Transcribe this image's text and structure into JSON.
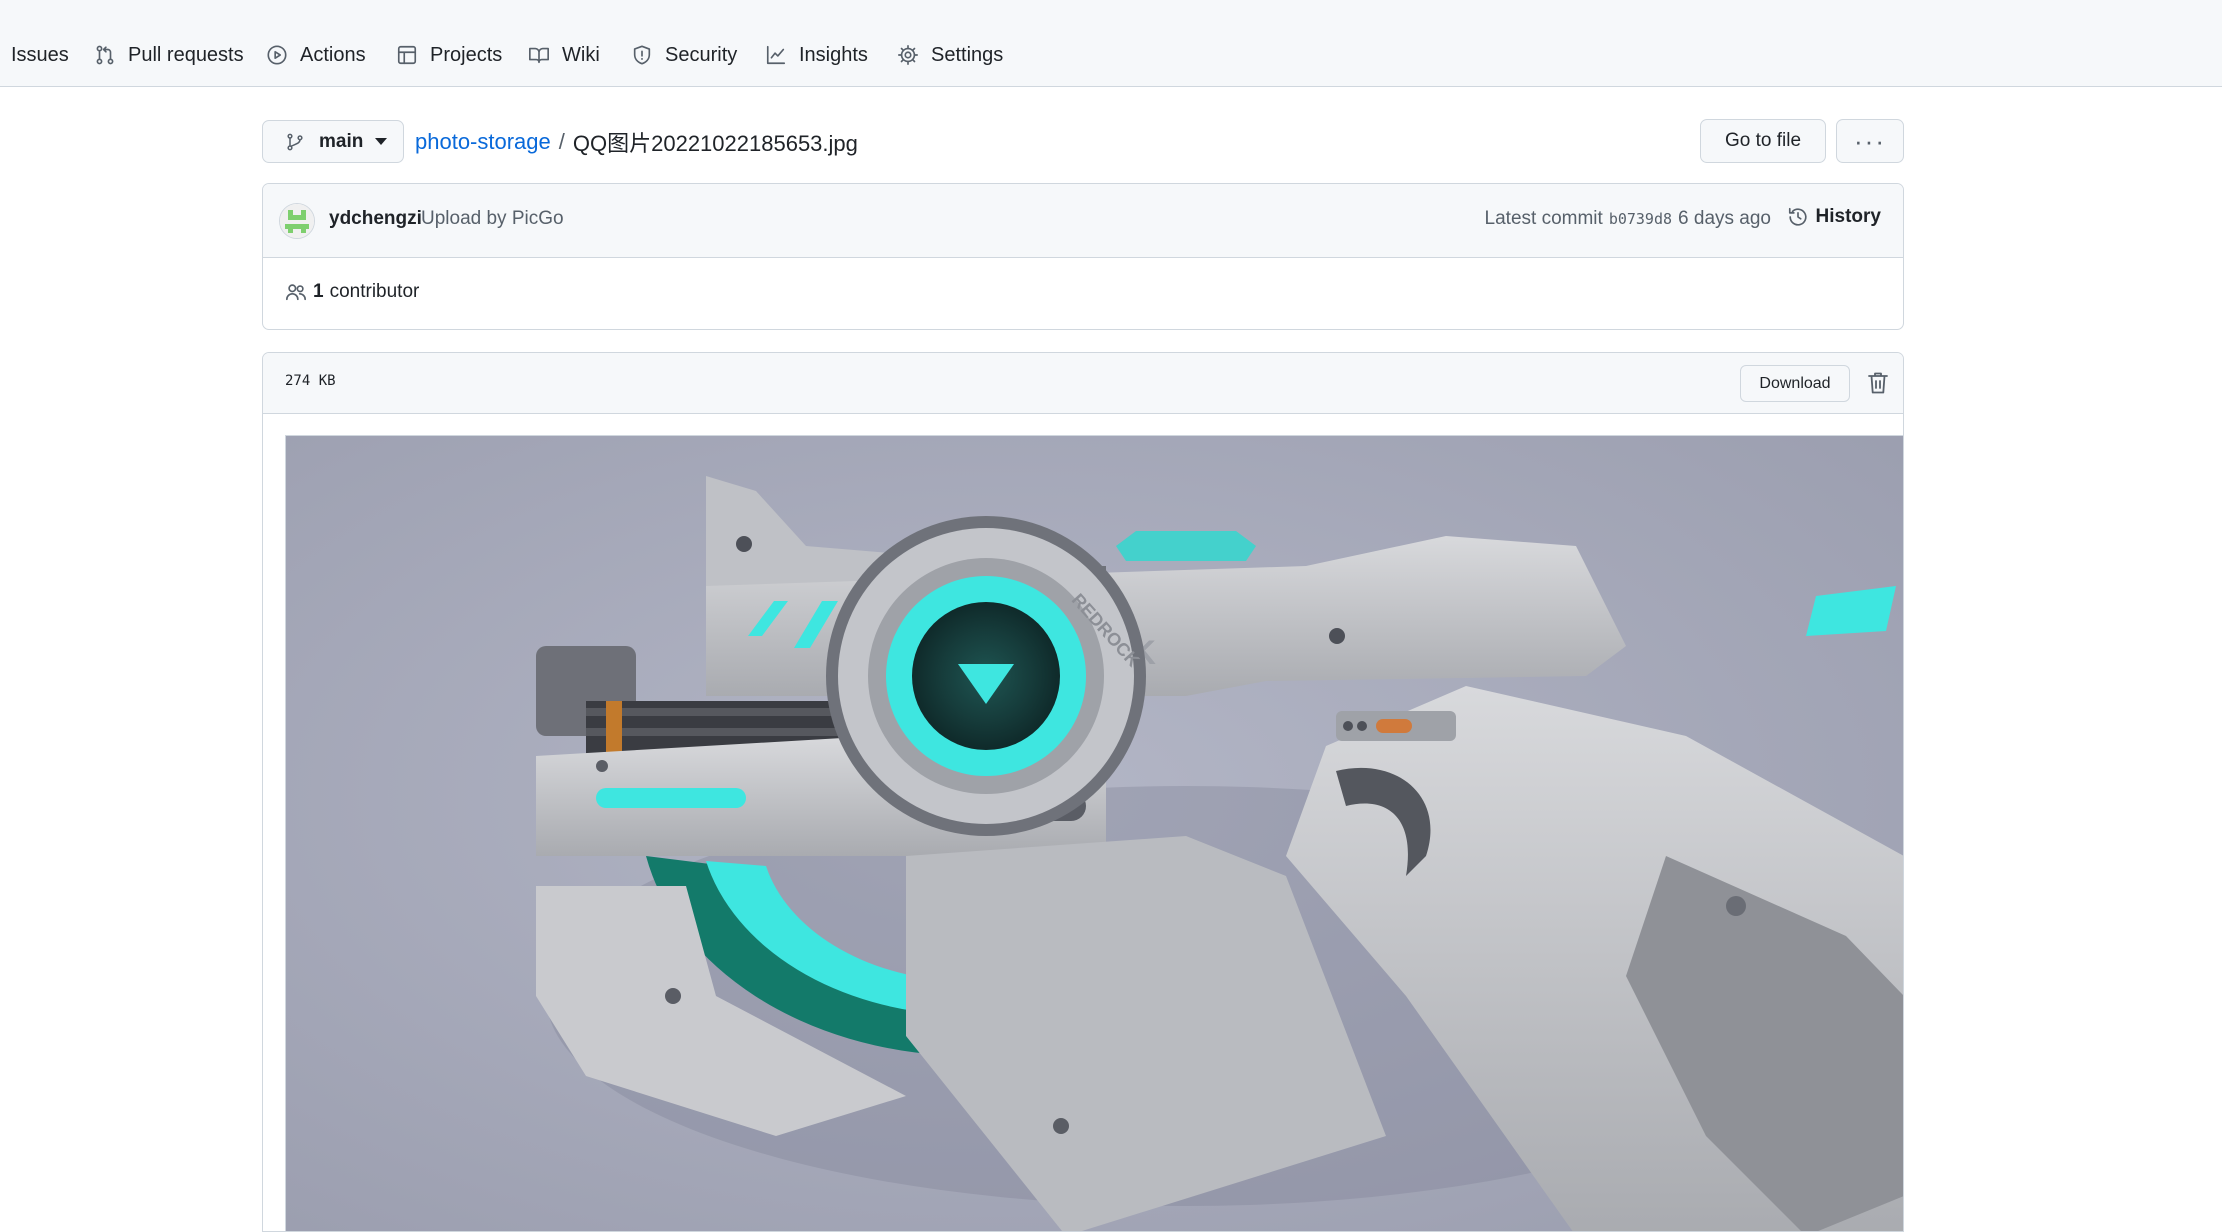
{
  "nav": {
    "items": [
      {
        "label": "Issues",
        "icon": "issue-icon"
      },
      {
        "label": "Pull requests",
        "icon": "pull-request-icon"
      },
      {
        "label": "Actions",
        "icon": "play-icon"
      },
      {
        "label": "Projects",
        "icon": "table-icon"
      },
      {
        "label": "Wiki",
        "icon": "book-icon"
      },
      {
        "label": "Security",
        "icon": "shield-icon"
      },
      {
        "label": "Insights",
        "icon": "graph-icon"
      },
      {
        "label": "Settings",
        "icon": "gear-icon"
      }
    ]
  },
  "breadcrumb": {
    "branch": "main",
    "repo": "photo-storage",
    "separator": "/",
    "file": "QQ图片20221022185653.jpg"
  },
  "actions": {
    "go_to_file": "Go to file",
    "more": "···"
  },
  "commit": {
    "author": "ydchengzi",
    "message": "Upload by PicGo",
    "latest_label": "Latest commit",
    "sha": "b0739d8",
    "time": "6 days ago",
    "history": "History"
  },
  "contributors": {
    "count": "1",
    "label": "contributor"
  },
  "file": {
    "size": "274 KB",
    "download": "Download"
  },
  "colors": {
    "link": "#0969da",
    "border": "#d0d7de",
    "subtle_bg": "#f6f8fa",
    "image_bg": "#a5a8b8",
    "teal_glow": "#3ee6e0"
  }
}
